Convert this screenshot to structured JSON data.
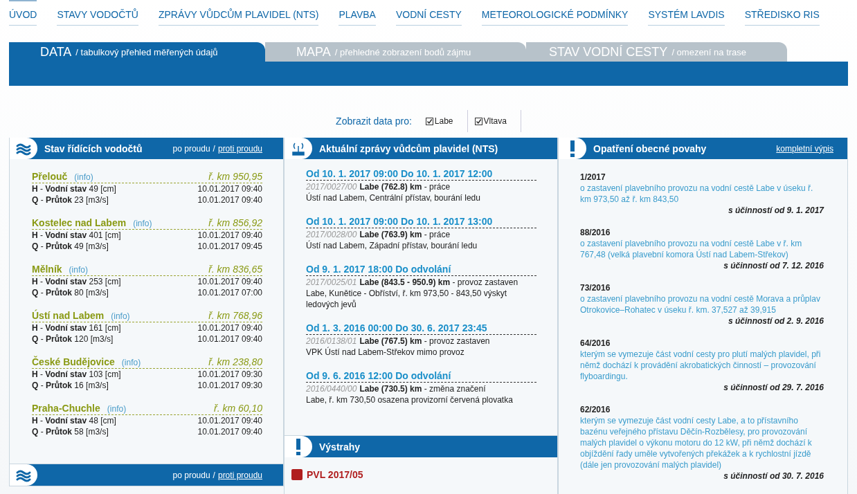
{
  "nav": [
    {
      "label": "ÚVOD",
      "selected": true
    },
    {
      "label": "STAVY VODOČTŮ",
      "selected": false
    },
    {
      "label": "ZPRÁVY VŮDCŮM PLAVIDEL (NTS)",
      "selected": false
    },
    {
      "label": "PLAVBA",
      "selected": false
    },
    {
      "label": "VODNÍ CESTY",
      "selected": false
    },
    {
      "label": "METEOROLOGICKÉ PODMÍNKY",
      "selected": false
    },
    {
      "label": "SYSTÉM LAVDIS",
      "selected": false
    },
    {
      "label": "STŘEDISKO RIS",
      "selected": false
    }
  ],
  "tabs": [
    {
      "title": "DATA",
      "subtitle": "/ tabulkový přehled měřených údajů",
      "selected": true
    },
    {
      "title": "MAPA",
      "subtitle": "/ přehledné zobrazení bodů zájmu",
      "selected": false
    },
    {
      "title": "STAV VODNÍ CESTY",
      "subtitle": "/ omezení na trase",
      "selected": false
    }
  ],
  "filter": {
    "label": "Zobrazit data pro:",
    "options": [
      {
        "label": "Labe",
        "checked": true
      },
      {
        "label": "Vltava",
        "checked": true
      }
    ]
  },
  "gauges": {
    "title": "Stav řídících vodočtů",
    "separator": "/",
    "links": [
      {
        "label": "po proudu",
        "selected": true
      },
      {
        "label": "proti proudu",
        "selected": false
      }
    ],
    "stations": [
      {
        "name": "Přelouč",
        "info": "(info)",
        "km": "ř. km 950,95",
        "rows": [
          {
            "label": "**H** - **Vodní stav** 49 [cm]",
            "time": "10.01.2017 09:40"
          },
          {
            "label": "**Q** - **Průtok** 23 [m3/s]",
            "time": "10.01.2017 09:40"
          }
        ]
      },
      {
        "name": "Kostelec nad Labem",
        "info": "(info)",
        "km": "ř. km 856,92",
        "rows": [
          {
            "label": "**H** - **Vodní stav** 401 [cm]",
            "time": "10.01.2017 09:40"
          },
          {
            "label": "**Q** - **Průtok** 49 [m3/s]",
            "time": "10.01.2017 09:45"
          }
        ]
      },
      {
        "name": "Mělník",
        "info": "(info)",
        "km": "ř. km 836,65",
        "rows": [
          {
            "label": "**H** - **Vodní stav** 253 [cm]",
            "time": "10.01.2017 09:40"
          },
          {
            "label": "**Q** - **Průtok** 80 [m3/s]",
            "time": "10.01.2017 07:00"
          }
        ]
      },
      {
        "name": "Ústí nad Labem",
        "info": "(info)",
        "km": "ř. km 768,96",
        "rows": [
          {
            "label": "**H** - **Vodní stav** 161 [cm]",
            "time": "10.01.2017 09:40"
          },
          {
            "label": "**Q** - **Průtok** 120 [m3/s]",
            "time": "10.01.2017 09:40"
          }
        ]
      },
      {
        "name": "České Budějovice",
        "info": "(info)",
        "km": "ř. km 238,80",
        "rows": [
          {
            "label": "**H** - **Vodní stav** 103 [cm]",
            "time": "10.01.2017 09:30"
          },
          {
            "label": "**Q** - **Průtok** 16 [m3/s]",
            "time": "10.01.2017 09:30"
          }
        ]
      },
      {
        "name": "Praha-Chuchle",
        "info": "(info)",
        "km": "ř. km 60,10",
        "rows": [
          {
            "label": "**H** - **Vodní stav** 48 [cm]",
            "time": "10.01.2017 09:40"
          },
          {
            "label": "**Q** - **Průtok** 58 [m3/s]",
            "time": "10.01.2017 09:40"
          }
        ]
      }
    ]
  },
  "gauges_2": {
    "separator": "/",
    "links": [
      {
        "label": "po proudu",
        "selected": true
      },
      {
        "label": "proti proudu",
        "selected": false
      }
    ]
  },
  "nts": {
    "title": "Aktuální zprávy vůdcům plavidel (NTS)",
    "messages": [
      {
        "period": "Od 10. 1. 2017 09:00 Do 10. 1. 2017 12:00",
        "code": "2017/0027/00",
        "subject": "**Labe (762.8) km** - práce",
        "detail": "Ústí nad Labem, Centrální přístav, bourání ledu"
      },
      {
        "period": "Od 10. 1. 2017 09:00 Do 10. 1. 2017 13:00",
        "code": "2017/0028/00",
        "subject": "**Labe (763.9) km** - práce",
        "detail": "Ústí nad Labem, Západní přístav, bourání ledu"
      },
      {
        "period": "Od 9. 1. 2017 18:00 Do odvolání",
        "code": "2017/0025/01",
        "subject": "**Labe (843.5 - 950.9) km** - provoz zastaven",
        "detail": "Labe, Kunětice - Obříství, ř. km 973,50 - 843,50 výskyt ledových jevů"
      },
      {
        "period": "Od 1. 3. 2016 00:00 Do 30. 6. 2017 23:45",
        "code": "2016/0138/01",
        "subject": "**Labe (767.5) km** - provoz zastaven",
        "detail": "VPK Ústí nad Labem-Střekov mimo provoz"
      },
      {
        "period": "Od 9. 6. 2016 12:00 Do odvolání",
        "code": "2016/0440/00",
        "subject": "**Labe (730.5) km** - změna značení",
        "detail": "Labe, ř. km 730,50 osazena provizorní červená plovatka"
      }
    ]
  },
  "warnings": {
    "title": "Výstrahy",
    "items": [
      {
        "label": "PVL 2017/05"
      }
    ]
  },
  "measures": {
    "title": "Opatření obecné povahy",
    "link": "kompletní výpis",
    "items": [
      {
        "number": "1/2017",
        "text": "o zastavení plavebního provozu na vodní cestě Labe v úseku ř. km 973,50 až ř. km 843,50",
        "effective": "s účinností od 9. 1. 2017"
      },
      {
        "number": "88/2016",
        "text": "o zastavení plavebního provozu na vodní cestě Labe v ř. km 767,48 (velká plavební komora Ústí nad Labem-Střekov)",
        "effective": "s účinností od 7. 12. 2016"
      },
      {
        "number": "73/2016",
        "text": "o zastavení plavebního provozu na vodní cestě Morava a průplav Otrokovice–Rohatec v úseku ř. km. 37,527 až 39,915",
        "effective": "s účinností od 2. 9. 2016"
      },
      {
        "number": "64/2016",
        "text": "kterým se vymezuje část vodní cesty pro plutí malých plavidel, při němž dochází k provádění akrobatických činností – provozování flyboardingu.",
        "effective": "s účinností od 29. 7. 2016"
      },
      {
        "number": "62/2016",
        "text": "kterým se vymezuje část vodní cesty Labe, a to přístavního bazénu veřejného přístavu Děčín-Rozbělesy, pro provozování malých plavidel o výkonu motoru do 12 kW, při němž dochází k objíždění řady uměle vytvořených překážek a k rychlostní jízdě (dále jen provozování malých plavidel)",
        "effective": "s účinností od 30. 7. 2016"
      }
    ]
  }
}
